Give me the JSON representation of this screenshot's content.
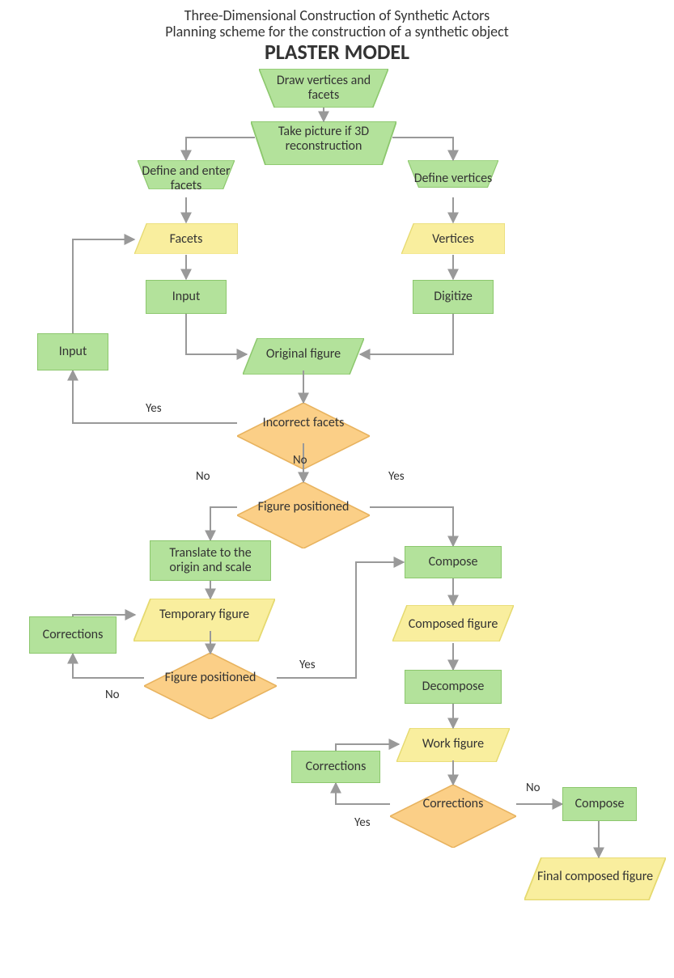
{
  "chart_data": {
    "type": "flowchart",
    "title": "Three-Dimensional Construction of Synthetic Actors",
    "subtitle": "Planning scheme for the construction of a synthetic object",
    "heading": "PLASTER MODEL",
    "nodes": [
      {
        "id": "draw",
        "shape": "trapezoid-down",
        "text": "Draw vertices and facets",
        "color": "green"
      },
      {
        "id": "take",
        "shape": "trapezoid-down",
        "text": "Take picture if 3D reconstruction",
        "color": "green"
      },
      {
        "id": "deffacets",
        "shape": "trapezoid-down",
        "text": "Define and enter facets",
        "color": "green"
      },
      {
        "id": "defvert",
        "shape": "trapezoid-down",
        "text": "Define vertices",
        "color": "green"
      },
      {
        "id": "facets",
        "shape": "trapezoid-up",
        "text": "Facets",
        "color": "yellow"
      },
      {
        "id": "vertices",
        "shape": "trapezoid-up",
        "text": "Vertices",
        "color": "yellow"
      },
      {
        "id": "input1",
        "shape": "rect",
        "text": "Input",
        "color": "green"
      },
      {
        "id": "digitize",
        "shape": "rect",
        "text": "Digitize",
        "color": "green"
      },
      {
        "id": "inputside",
        "shape": "rect",
        "text": "Input",
        "color": "green"
      },
      {
        "id": "orig",
        "shape": "parallelogram",
        "text": "Original figure",
        "color": "green"
      },
      {
        "id": "incfac",
        "shape": "diamond",
        "text": "Incorrect facets",
        "color": "orange"
      },
      {
        "id": "figpos1",
        "shape": "diamond",
        "text": "Figure positioned",
        "color": "orange"
      },
      {
        "id": "translate",
        "shape": "rect",
        "text": "Translate to the origin and scale",
        "color": "green"
      },
      {
        "id": "temp",
        "shape": "parallelogram",
        "text": "Temporary figure",
        "color": "yellow"
      },
      {
        "id": "corr1",
        "shape": "rect",
        "text": "Corrections",
        "color": "green"
      },
      {
        "id": "figpos2",
        "shape": "diamond",
        "text": "Figure positioned",
        "color": "orange"
      },
      {
        "id": "compose1",
        "shape": "rect",
        "text": "Compose",
        "color": "green"
      },
      {
        "id": "compfig",
        "shape": "parallelogram",
        "text": "Composed figure",
        "color": "yellow"
      },
      {
        "id": "decomp",
        "shape": "rect",
        "text": "Decompose",
        "color": "green"
      },
      {
        "id": "work",
        "shape": "parallelogram",
        "text": "Work figure",
        "color": "yellow"
      },
      {
        "id": "corr2",
        "shape": "rect",
        "text": "Corrections",
        "color": "green"
      },
      {
        "id": "corrdec",
        "shape": "diamond",
        "text": "Corrections",
        "color": "orange"
      },
      {
        "id": "compose2",
        "shape": "rect",
        "text": "Compose",
        "color": "green"
      },
      {
        "id": "final",
        "shape": "parallelogram",
        "text": "Final composed figure",
        "color": "yellow"
      }
    ],
    "edges": [
      {
        "from": "draw",
        "to": "take"
      },
      {
        "from": "take",
        "to": "deffacets"
      },
      {
        "from": "take",
        "to": "defvert"
      },
      {
        "from": "deffacets",
        "to": "facets"
      },
      {
        "from": "defvert",
        "to": "vertices"
      },
      {
        "from": "facets",
        "to": "input1"
      },
      {
        "from": "vertices",
        "to": "digitize"
      },
      {
        "from": "input1",
        "to": "orig"
      },
      {
        "from": "digitize",
        "to": "orig"
      },
      {
        "from": "orig",
        "to": "incfac"
      },
      {
        "from": "incfac",
        "to": "inputside",
        "label": "Yes"
      },
      {
        "from": "inputside",
        "to": "facets"
      },
      {
        "from": "incfac",
        "to": "figpos1",
        "label": "No"
      },
      {
        "from": "figpos1",
        "to": "translate",
        "label": "No"
      },
      {
        "from": "figpos1",
        "to": "compose1",
        "label": "Yes"
      },
      {
        "from": "translate",
        "to": "temp"
      },
      {
        "from": "temp",
        "to": "figpos2"
      },
      {
        "from": "figpos2",
        "to": "corr1",
        "label": "No"
      },
      {
        "from": "corr1",
        "to": "temp"
      },
      {
        "from": "figpos2",
        "to": "compose1",
        "label": "Yes"
      },
      {
        "from": "compose1",
        "to": "compfig"
      },
      {
        "from": "compfig",
        "to": "decomp"
      },
      {
        "from": "decomp",
        "to": "work"
      },
      {
        "from": "work",
        "to": "corrdec"
      },
      {
        "from": "corrdec",
        "to": "corr2",
        "label": "Yes"
      },
      {
        "from": "corr2",
        "to": "work"
      },
      {
        "from": "corrdec",
        "to": "compose2",
        "label": "No"
      },
      {
        "from": "compose2",
        "to": "final"
      }
    ],
    "labels": {
      "yes": "Yes",
      "no": "No"
    }
  }
}
